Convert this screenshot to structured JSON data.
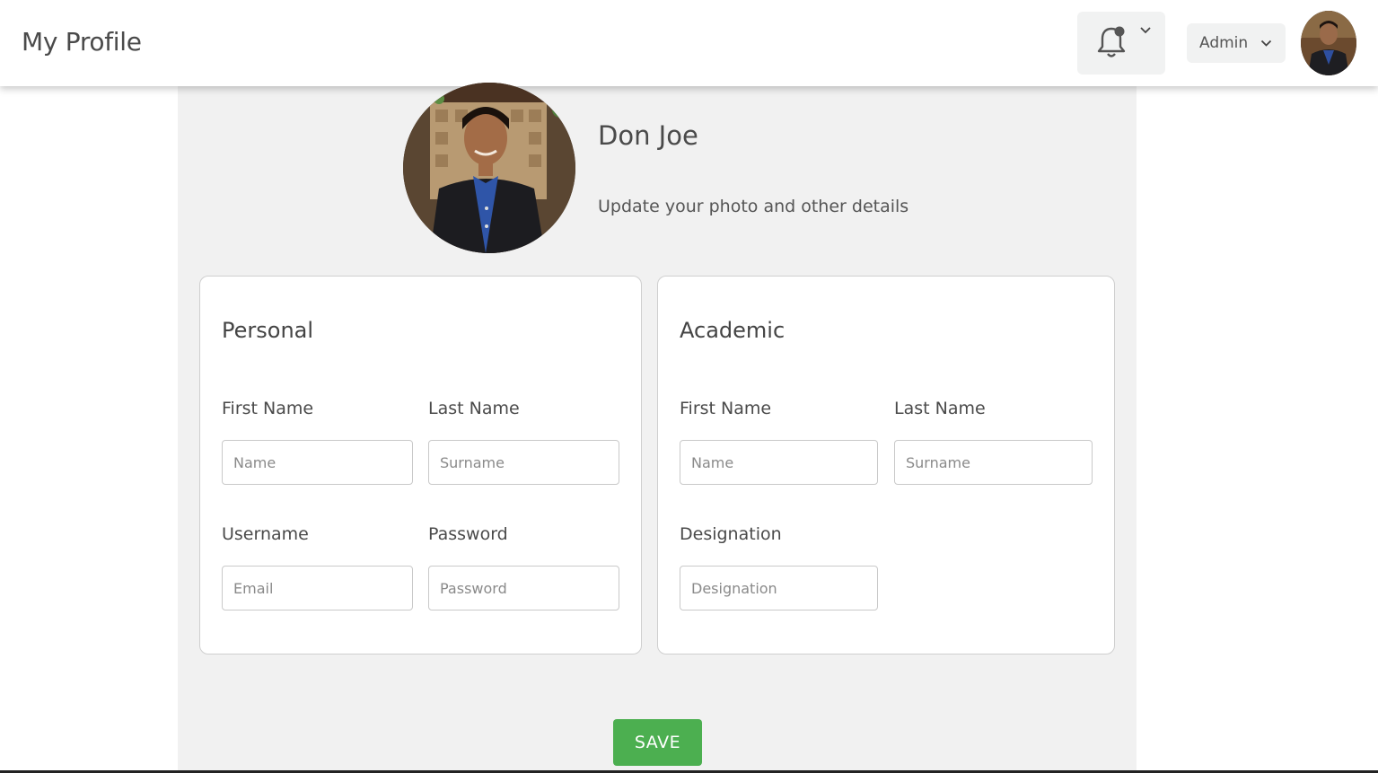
{
  "header": {
    "title": "My Profile",
    "admin_label": "Admin"
  },
  "icons": {
    "notification": "bell-icon",
    "dropdown": "chevron-down-icon"
  },
  "profile": {
    "name": "Don Joe",
    "subtitle": "Update your photo and other details"
  },
  "personal": {
    "title": "Personal",
    "first_name_label": "First Name",
    "first_name_placeholder": "Name",
    "first_name_value": "",
    "last_name_label": "Last Name",
    "last_name_placeholder": "Surname",
    "last_name_value": "",
    "username_label": "Username",
    "username_placeholder": "Email",
    "username_value": "",
    "password_label": "Password",
    "password_placeholder": "Password",
    "password_value": ""
  },
  "academic": {
    "title": "Academic",
    "first_name_label": "First Name",
    "first_name_placeholder": "Name",
    "first_name_value": "",
    "last_name_label": "Last Name",
    "last_name_placeholder": "Surname",
    "last_name_value": "",
    "designation_label": "Designation",
    "designation_placeholder": "Designation",
    "designation_value": ""
  },
  "actions": {
    "save_label": "SAVE"
  },
  "colors": {
    "save_button": "#4caf50",
    "panel_background": "#f1f1f1"
  }
}
